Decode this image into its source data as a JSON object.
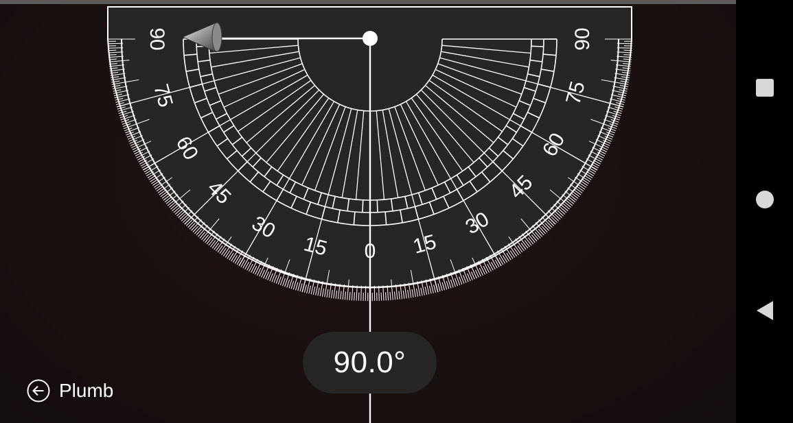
{
  "protractor": {
    "readout": "90.0°",
    "angle_degrees": 90.0,
    "scale_labels_left": [
      "90",
      "75",
      "60",
      "45",
      "30",
      "15"
    ],
    "center_label": "0",
    "scale_labels_right": [
      "15",
      "30",
      "45",
      "60",
      "75",
      "90"
    ]
  },
  "bottom_bar": {
    "back_label": "Plumb"
  },
  "system_nav": {
    "recents": "square-icon",
    "home": "circle-icon",
    "back": "triangle-back-icon"
  },
  "colors": {
    "background": "#1a1111",
    "protractor_body": "#262626",
    "lines": "#ffffff",
    "pill": "#262626",
    "nav_bar": "#000000",
    "nav_icons": "#d8d8d8"
  }
}
